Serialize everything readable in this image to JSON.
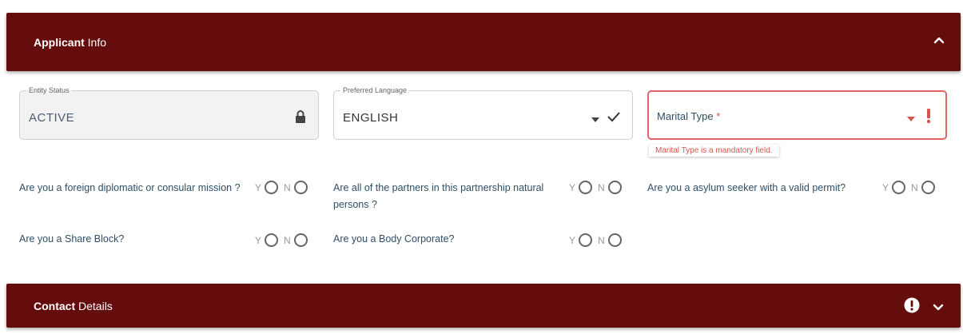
{
  "applicant_panel": {
    "title_bold": "Applicant",
    "title_rest": " Info",
    "toggle_icon": "chevron-up-icon"
  },
  "fields": {
    "entity_status": {
      "label": "Entity Status",
      "value": "ACTIVE",
      "icon": "lock-icon"
    },
    "preferred_language": {
      "label": "Preferred Language",
      "value": "ENGLISH",
      "icons": [
        "caret-down-icon",
        "checkmark-icon"
      ]
    },
    "marital_type": {
      "placeholder": "Marital Type",
      "required_mark": "*",
      "error": "Marital Type is a mandatory field.",
      "icons": [
        "caret-down-icon",
        "exclamation-icon"
      ]
    }
  },
  "yes_label": "Y",
  "no_label": "N",
  "questions": [
    {
      "text": "Are you a foreign diplomatic or consular mission ?"
    },
    {
      "text": "Are all of the partners in this partnership natural persons ?"
    },
    {
      "text": "Are you a asylum seeker with a valid permit?"
    },
    {
      "text": "Are you a Share Block?"
    },
    {
      "text": "Are you a Body Corporate?"
    }
  ],
  "contact_panel": {
    "title_bold": "Contact",
    "title_rest": " Details",
    "icons": [
      "alert-circle-icon",
      "chevron-down-icon"
    ]
  },
  "colors": {
    "header_bg": "#650c0c",
    "error": "#d9534f",
    "text": "#2f4f66"
  }
}
